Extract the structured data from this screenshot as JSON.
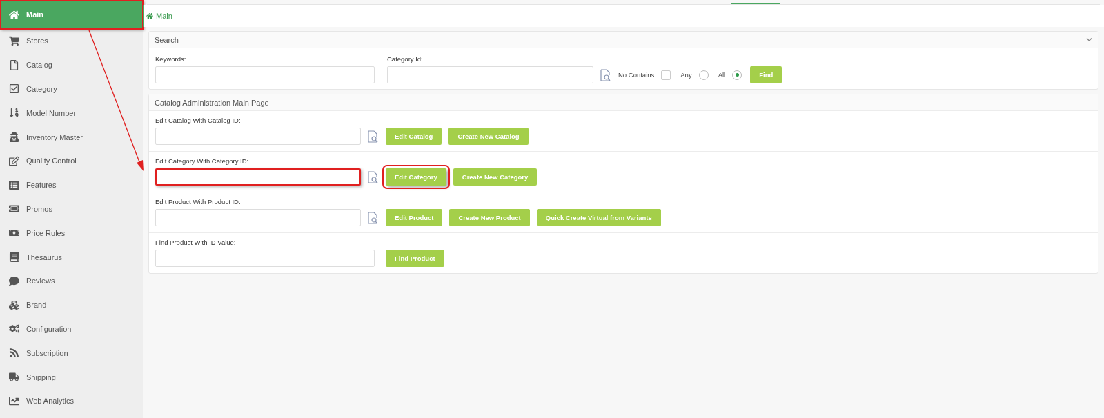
{
  "sidebar": {
    "items": [
      {
        "label": "Main",
        "selected": true,
        "highlighted": true
      },
      {
        "label": "Stores",
        "selected": false,
        "highlighted": false
      },
      {
        "label": "Catalog",
        "selected": false,
        "highlighted": false
      },
      {
        "label": "Category",
        "selected": false,
        "highlighted": false
      },
      {
        "label": "Model Number",
        "selected": false,
        "highlighted": false
      },
      {
        "label": "Inventory Master",
        "selected": false,
        "highlighted": false
      },
      {
        "label": "Quality Control",
        "selected": false,
        "highlighted": false
      },
      {
        "label": "Features",
        "selected": false,
        "highlighted": false
      },
      {
        "label": "Promos",
        "selected": false,
        "highlighted": false
      },
      {
        "label": "Price Rules",
        "selected": false,
        "highlighted": false
      },
      {
        "label": "Thesaurus",
        "selected": false,
        "highlighted": false
      },
      {
        "label": "Reviews",
        "selected": false,
        "highlighted": false
      },
      {
        "label": "Brand",
        "selected": false,
        "highlighted": false
      },
      {
        "label": "Configuration",
        "selected": false,
        "highlighted": false
      },
      {
        "label": "Subscription",
        "selected": false,
        "highlighted": false
      },
      {
        "label": "Shipping",
        "selected": false,
        "highlighted": false
      },
      {
        "label": "Web Analytics",
        "selected": false,
        "highlighted": false
      }
    ]
  },
  "breadcrumb": {
    "label": "Main"
  },
  "search": {
    "title": "Search",
    "expanded": true,
    "keywords": {
      "label": "Keywords:"
    },
    "category_id": {
      "label": "Category Id:"
    },
    "no_contains": {
      "label": "No Contains",
      "checked": false
    },
    "match": [
      {
        "label": "Any",
        "selected": false
      },
      {
        "label": "All",
        "selected": true
      }
    ],
    "find_button": "Find"
  },
  "admin": {
    "title": "Catalog Administration Main Page",
    "rows": [
      {
        "label": "Edit Catalog With Catalog ID:",
        "lookup": true,
        "wide": false,
        "highlighted": false,
        "buttons": [
          {
            "label": "Edit Catalog",
            "highlighted": false
          },
          {
            "label": "Create New Catalog",
            "highlighted": false
          }
        ]
      },
      {
        "label": "Edit Category With Category ID:",
        "lookup": true,
        "wide": false,
        "highlighted": true,
        "buttons": [
          {
            "label": "Edit Category",
            "highlighted": true
          },
          {
            "label": "Create New Category",
            "highlighted": false
          }
        ]
      },
      {
        "label": "Edit Product With Product ID:",
        "lookup": true,
        "wide": false,
        "highlighted": false,
        "buttons": [
          {
            "label": "Edit Product",
            "highlighted": false
          },
          {
            "label": "Create New Product",
            "highlighted": false
          },
          {
            "label": "Quick Create Virtual from Variants",
            "highlighted": false
          }
        ]
      },
      {
        "label": "Find Product With ID Value:",
        "lookup": false,
        "wide": true,
        "highlighted": false,
        "buttons": [
          {
            "label": "Find Product",
            "highlighted": false
          }
        ]
      }
    ]
  }
}
